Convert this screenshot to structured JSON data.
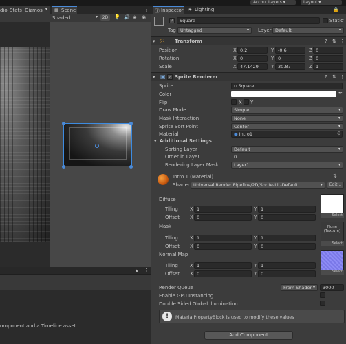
{
  "topbar": {
    "account_label": "Account",
    "layers_label": "Layers",
    "layout_label": "Layout"
  },
  "left": {
    "tabs": [
      "dio",
      "Stats",
      "Gizmos"
    ],
    "bottom_text": "omponent and a Timeline asset"
  },
  "scene": {
    "tab_label": "Scene",
    "shading_mode": "Shaded",
    "mode_2d": "2D"
  },
  "inspector": {
    "tab_label": "Inspector",
    "lighting_tab": "Lighting",
    "object_name": "Square",
    "static_label": "Static",
    "tag_label": "Tag",
    "tag_value": "Untagged",
    "layer_label": "Layer",
    "layer_value": "Default",
    "transform": {
      "title": "Transform",
      "position_label": "Position",
      "rotation_label": "Rotation",
      "scale_label": "Scale",
      "position": {
        "x": "0.2",
        "y": "-0.6",
        "z": "0"
      },
      "rotation": {
        "x": "0",
        "y": "0",
        "z": "0"
      },
      "scale": {
        "x": "47.1429",
        "y": "30.87",
        "z": "1"
      }
    },
    "sprite_renderer": {
      "title": "Sprite Renderer",
      "sprite_label": "Sprite",
      "sprite_value": "Square",
      "color_label": "Color",
      "flip_label": "Flip",
      "flip_x": "X",
      "flip_y": "Y",
      "draw_mode_label": "Draw Mode",
      "draw_mode_value": "Simple",
      "mask_interaction_label": "Mask Interaction",
      "mask_interaction_value": "None",
      "sprite_sort_point_label": "Sprite Sort Point",
      "sprite_sort_point_value": "Center",
      "material_label": "Material",
      "material_value": "Intro1",
      "additional_settings_label": "Additional Settings",
      "sorting_layer_label": "Sorting Layer",
      "sorting_layer_value": "Default",
      "order_in_layer_label": "Order in Layer",
      "order_in_layer_value": "0",
      "rendering_layer_mask_label": "Rendering Layer Mask",
      "rendering_layer_mask_value": "Layer1"
    },
    "material": {
      "title": "Intro 1 (Material)",
      "shader_label": "Shader",
      "shader_value": "Universal Render Pipeline/2D/Sprite-Lit-Default",
      "edit_label": "Edit...",
      "diffuse_label": "Diffuse",
      "mask_label": "Mask",
      "normal_map_label": "Normal Map",
      "tiling_label": "Tiling",
      "offset_label": "Offset",
      "x_label": "X",
      "y_label": "Y",
      "diffuse_tiling": {
        "x": "1",
        "y": "1"
      },
      "diffuse_offset": {
        "x": "0",
        "y": "0"
      },
      "mask_tiling": {
        "x": "1",
        "y": "1"
      },
      "mask_offset": {
        "x": "0",
        "y": "0"
      },
      "normal_tiling": {
        "x": "1",
        "y": "1"
      },
      "normal_offset": {
        "x": "0",
        "y": "0"
      },
      "select_label": "Select",
      "none_texture_label": "None\n(Texture)",
      "render_queue_label": "Render Queue",
      "render_queue_mode": "From Shader",
      "render_queue_value": "3000",
      "gpu_instancing_label": "Enable GPU Instancing",
      "double_sided_label": "Double Sided Global Illumination",
      "info_text": "MaterialPropertyBlock is used to modify these values"
    },
    "add_component_label": "Add Component"
  },
  "colors": {
    "accent": "#4a8ad8",
    "inspector_bg": "#3c3c3c",
    "scene_bg": "#474747"
  }
}
